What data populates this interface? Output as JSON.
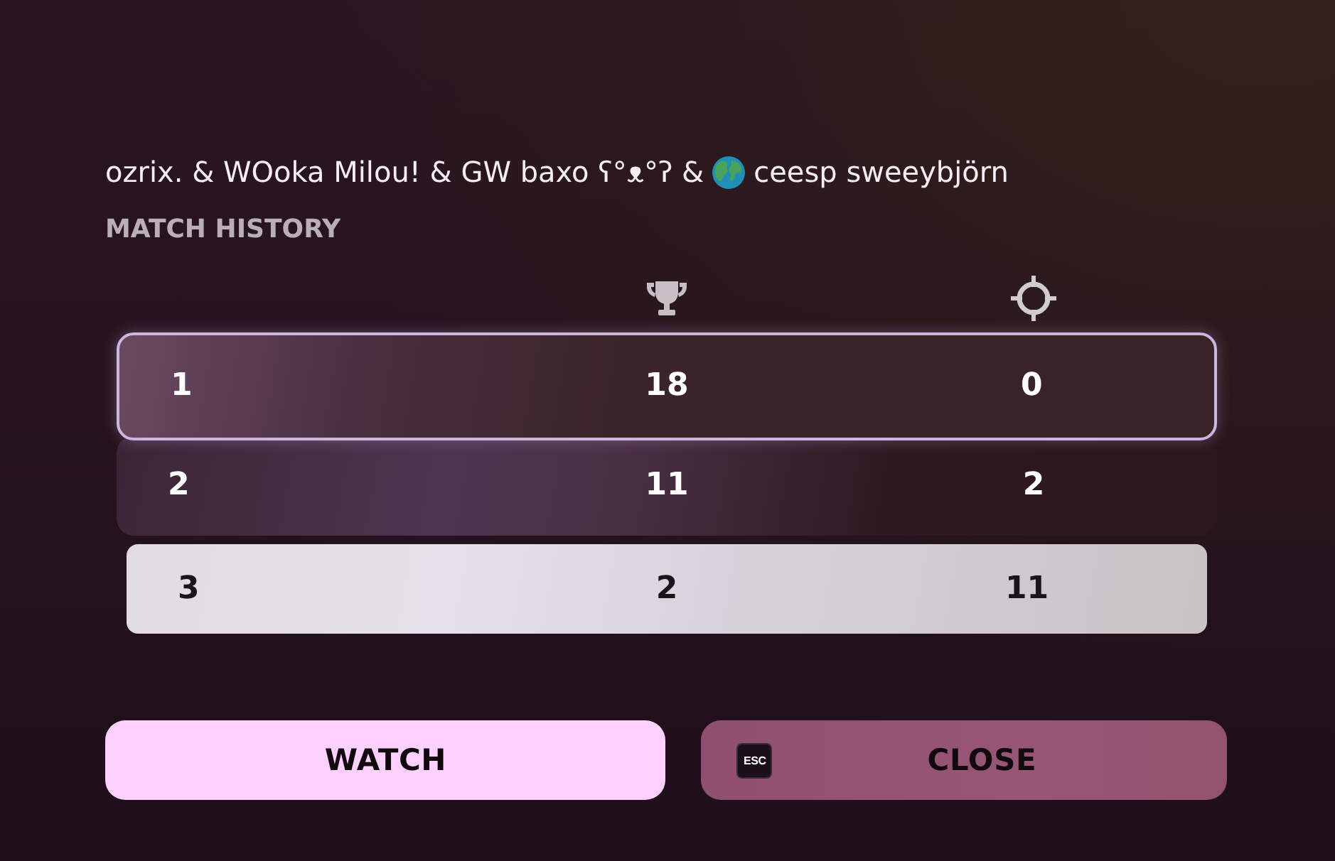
{
  "party": {
    "names_before_icon": "ozrix. & WOoka Milou! & GW baxo ʕ°ᴥ°ʔ &",
    "names_after_icon": "ceesp sweeybjörn"
  },
  "section_title": "MATCH HISTORY",
  "table": {
    "rows": [
      {
        "cells": [
          "1",
          "18",
          "0"
        ],
        "selected": true,
        "hovered": false
      },
      {
        "cells": [
          "2",
          "11",
          "2"
        ],
        "selected": false,
        "hovered": false
      },
      {
        "cells": [
          "3",
          "2",
          "11"
        ],
        "selected": false,
        "hovered": true
      }
    ]
  },
  "buttons": [
    {
      "kind": "primary",
      "label": "WATCH"
    },
    {
      "kind": "secondary",
      "label": "CLOSE",
      "key_hint": "ESC"
    }
  ]
}
